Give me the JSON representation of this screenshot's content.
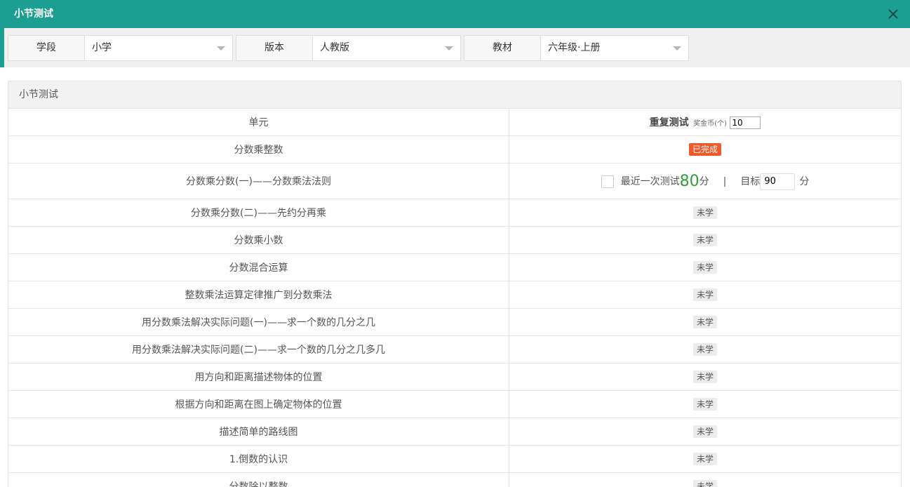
{
  "dialog": {
    "title": "小节测试"
  },
  "filters": [
    {
      "label": "学段",
      "value": "小学"
    },
    {
      "label": "版本",
      "value": "人教版"
    },
    {
      "label": "教材",
      "value": "六年级·上册"
    }
  ],
  "panel": {
    "title": "小节测试",
    "col_unit": "单元",
    "col_repeat": "重复测试",
    "coin_label": "奖金币(个)",
    "coin_value": "10"
  },
  "rows": [
    {
      "unit": "分数乘整数",
      "status": "已完成"
    },
    {
      "unit": "分数乘分数(一)——分数乘法法则",
      "last_label": "最近一次测试",
      "last_score": "80",
      "score_unit": "分",
      "separator": "|",
      "target_label": "目标",
      "target_value": "90",
      "target_unit": "分"
    },
    {
      "unit": "分数乘分数(二)——先约分再乘",
      "status": "未学"
    },
    {
      "unit": "分数乘小数",
      "status": "未学"
    },
    {
      "unit": "分数混合运算",
      "status": "未学"
    },
    {
      "unit": "整数乘法运算定律推广到分数乘法",
      "status": "未学"
    },
    {
      "unit": "用分数乘法解决实际问题(一)——求一个数的几分之几",
      "status": "未学"
    },
    {
      "unit": "用分数乘法解决实际问题(二)——求一个数的几分之几多几",
      "status": "未学"
    },
    {
      "unit": "用方向和距离描述物体的位置",
      "status": "未学"
    },
    {
      "unit": "根据方向和距离在图上确定物体的位置",
      "status": "未学"
    },
    {
      "unit": "描述简单的路线图",
      "status": "未学"
    },
    {
      "unit": "1.倒数的认识",
      "status": "未学"
    },
    {
      "unit": "分数除以整数",
      "status": "未学"
    }
  ]
}
